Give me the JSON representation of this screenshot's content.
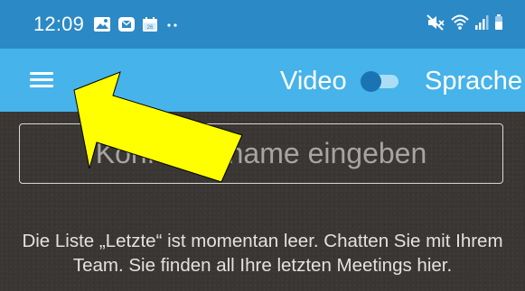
{
  "status_bar": {
    "time": "12:09",
    "background_color": "#2b89c6",
    "left_icons": [
      "gallery-icon",
      "mail-icon",
      "calendar-icon",
      "more-notifications-icon"
    ],
    "right_icons": [
      "mute-icon",
      "wifi-icon",
      "signal-icon",
      "battery-icon"
    ],
    "calendar_day": "26"
  },
  "app_bar": {
    "background_color": "#46b3ea",
    "menu_icon": "hamburger-menu-icon",
    "video_label": "Video",
    "language_label": "Sprache",
    "toggle_state": "off"
  },
  "main": {
    "background_color": "#3a3634",
    "conference_input": {
      "value": "",
      "placeholder": "Konferenzname eingeben"
    },
    "empty_message": "Die Liste „Letzte“ ist momentan leer. Chatten Sie mit Ihrem Team. Sie finden all Ihre letzten Meetings hier."
  },
  "annotation": {
    "type": "arrow",
    "color": "#ffff00",
    "outline_color": "#000000",
    "points_to": "hamburger-menu-icon"
  }
}
